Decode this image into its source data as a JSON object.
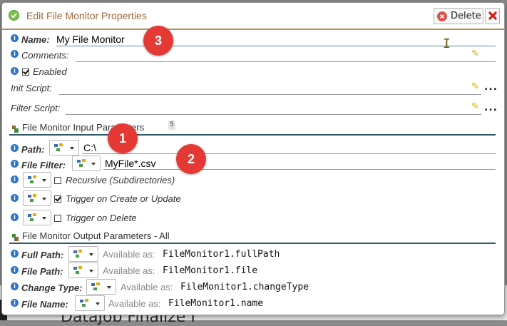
{
  "dialog": {
    "title": "Edit File Monitor Properties",
    "delete_label": "Delete"
  },
  "fields": {
    "name_label": "Name:",
    "name_value": "My File Monitor",
    "comments_label": "Comments:",
    "enabled_label": "Enabled",
    "enabled_checked": true,
    "init_script_label": "Init Script:",
    "filter_script_label": "Filter Script:",
    "dots_label": "..."
  },
  "input_section": {
    "title": "File Monitor Input Parameters",
    "badge": "5",
    "path_label": "Path:",
    "path_value": "C:\\",
    "file_filter_label": "File Filter:",
    "file_filter_value": "MyFile*.csv",
    "recursive_label": "Recursive (Subdirectories)",
    "recursive_checked": false,
    "trigger_create_label": "Trigger on Create or Update",
    "trigger_create_checked": true,
    "trigger_delete_label": "Trigger on Delete",
    "trigger_delete_checked": false
  },
  "output_section": {
    "title": "File Monitor Output Parameters - All",
    "available_as": "Available as:",
    "rows": [
      {
        "label": "Full Path:",
        "value": "FileMonitor1.fullPath"
      },
      {
        "label": "File Path:",
        "value": "FileMonitor1.file"
      },
      {
        "label": "Change Type:",
        "value": "FileMonitor1.changeType"
      },
      {
        "label": "File Name:",
        "value": "FileMonitor1.name"
      }
    ]
  },
  "callouts": [
    "1",
    "2",
    "3"
  ],
  "background": {
    "partial_text": "DataJob Finalize I"
  },
  "colors": {
    "title": "#a0693a",
    "accent_line": "#b88e5c",
    "info_icon": "#2f76c9",
    "callout": "#e53935",
    "section_line": "#2f5a6a"
  }
}
